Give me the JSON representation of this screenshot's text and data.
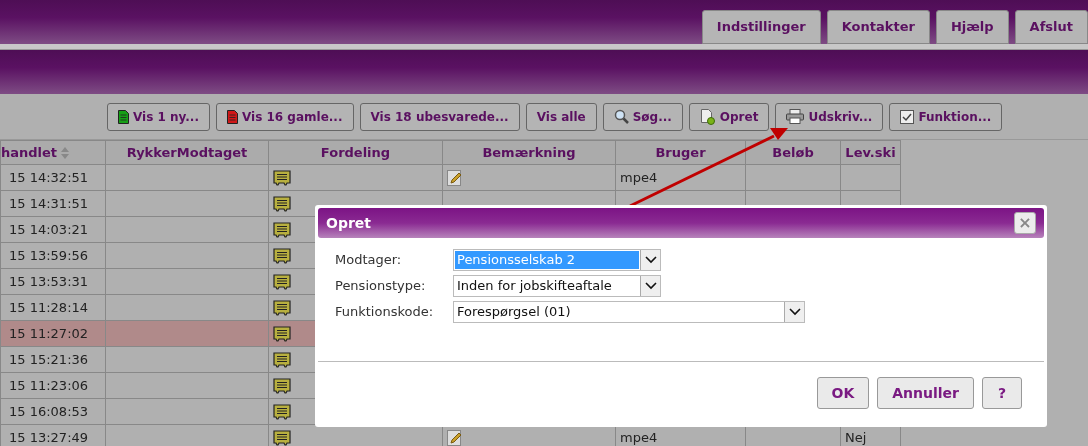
{
  "top_tabs": [
    "Indstillinger",
    "Kontakter",
    "Hjælp",
    "Afslut"
  ],
  "toolbar": [
    {
      "kind": "new",
      "label": "Vis 1 ny..."
    },
    {
      "kind": "old",
      "label": "Vis 16 gamle..."
    },
    {
      "kind": "plain",
      "label": "Vis 18 ubesvarede..."
    },
    {
      "kind": "plain",
      "label": "Vis alle"
    },
    {
      "kind": "search",
      "label": "Søg..."
    },
    {
      "kind": "create",
      "label": "Opret"
    },
    {
      "kind": "print",
      "label": "Udskriv..."
    },
    {
      "kind": "function",
      "label": "Funktion..."
    }
  ],
  "table": {
    "columns": [
      "handlet",
      "RykkerModtaget",
      "Fordeling",
      "Bemærkning",
      "Bruger",
      "Beløb",
      "Lev.ski"
    ],
    "rows": [
      {
        "column_1": "15 14:32:51",
        "selected": false,
        "note": true,
        "bruger": "mpe4"
      },
      {
        "column_1": "15 14:31:51",
        "selected": false,
        "note": false
      },
      {
        "column_1": "15 14:03:21",
        "selected": false,
        "note": false
      },
      {
        "column_1": "15 13:59:56",
        "selected": false,
        "note": false
      },
      {
        "column_1": "15 13:53:31",
        "selected": false,
        "note": false
      },
      {
        "column_1": "15 11:28:14",
        "selected": false,
        "note": false
      },
      {
        "column_1": "15 11:27:02",
        "selected": true,
        "note": false
      },
      {
        "column_1": "15 15:21:36",
        "selected": false,
        "note": false
      },
      {
        "column_1": "15 11:23:06",
        "selected": false,
        "note": false
      },
      {
        "column_1": "15 16:08:53",
        "selected": false,
        "note": false
      },
      {
        "column_1": "15 13:27:49",
        "selected": false,
        "note": true,
        "bruger": "mpe4",
        "lev_ski": "Nej"
      }
    ]
  },
  "dialog": {
    "title": "Opret",
    "close": "×",
    "fields": [
      {
        "label": "Modtager:",
        "value": "Pensionsselskab 2",
        "selected": true,
        "wide": false
      },
      {
        "label": "Pensionstype:",
        "value": "Inden for jobskifteaftale",
        "selected": false,
        "wide": false
      },
      {
        "label": "Funktionskode:",
        "value": "Forespørgsel (01)",
        "selected": false,
        "wide": true
      }
    ],
    "buttons": [
      "OK",
      "Annuller",
      "?"
    ]
  }
}
